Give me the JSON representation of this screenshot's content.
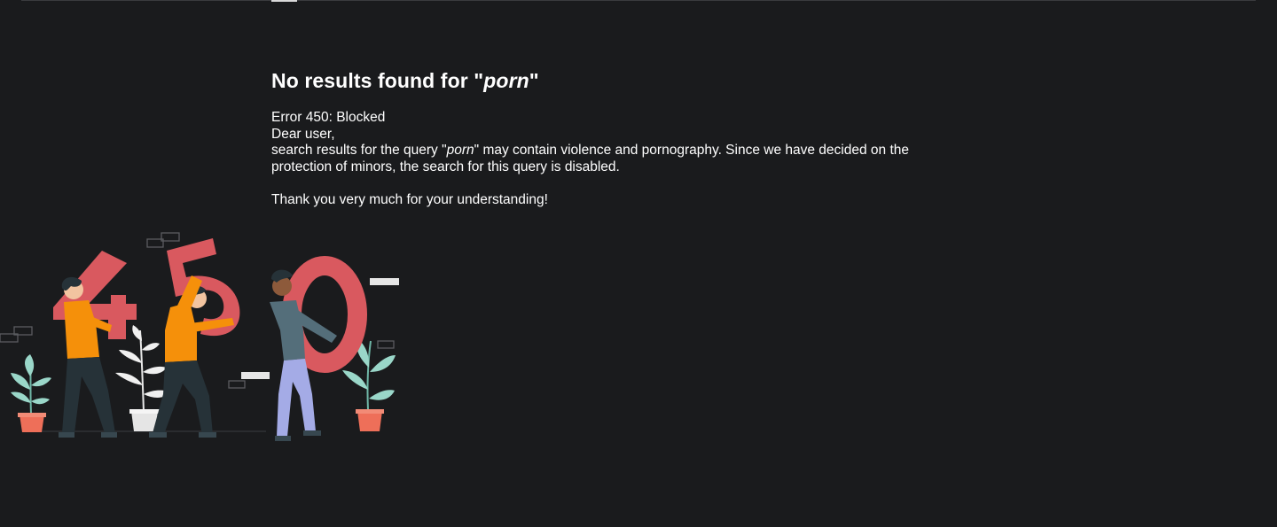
{
  "page": {
    "title_prefix": "No results found for \"",
    "query": "porn",
    "title_suffix": "\"",
    "error_line": "Error 450: Blocked",
    "greeting": "Dear user,",
    "msg_part1": "search results for the query \"",
    "msg_query": "porn",
    "msg_part2": "\" may contain violence and pornography. Since we have decided on the",
    "msg_line2": "protection of minors, the search for this query is disabled.",
    "thanks": "Thank you very much for your understanding!"
  },
  "colors": {
    "background": "#1a1b1d",
    "text": "#ffffff",
    "digit_red": "#d9595f",
    "shirt_orange": "#f5900a",
    "pants_dark": "#263238",
    "pants_lavender": "#a4abe6",
    "plant_green": "#9ad7c9",
    "pot_coral": "#ee6f59"
  },
  "illustration": {
    "icon": "error-450-people-carrying-digits-illustration"
  }
}
